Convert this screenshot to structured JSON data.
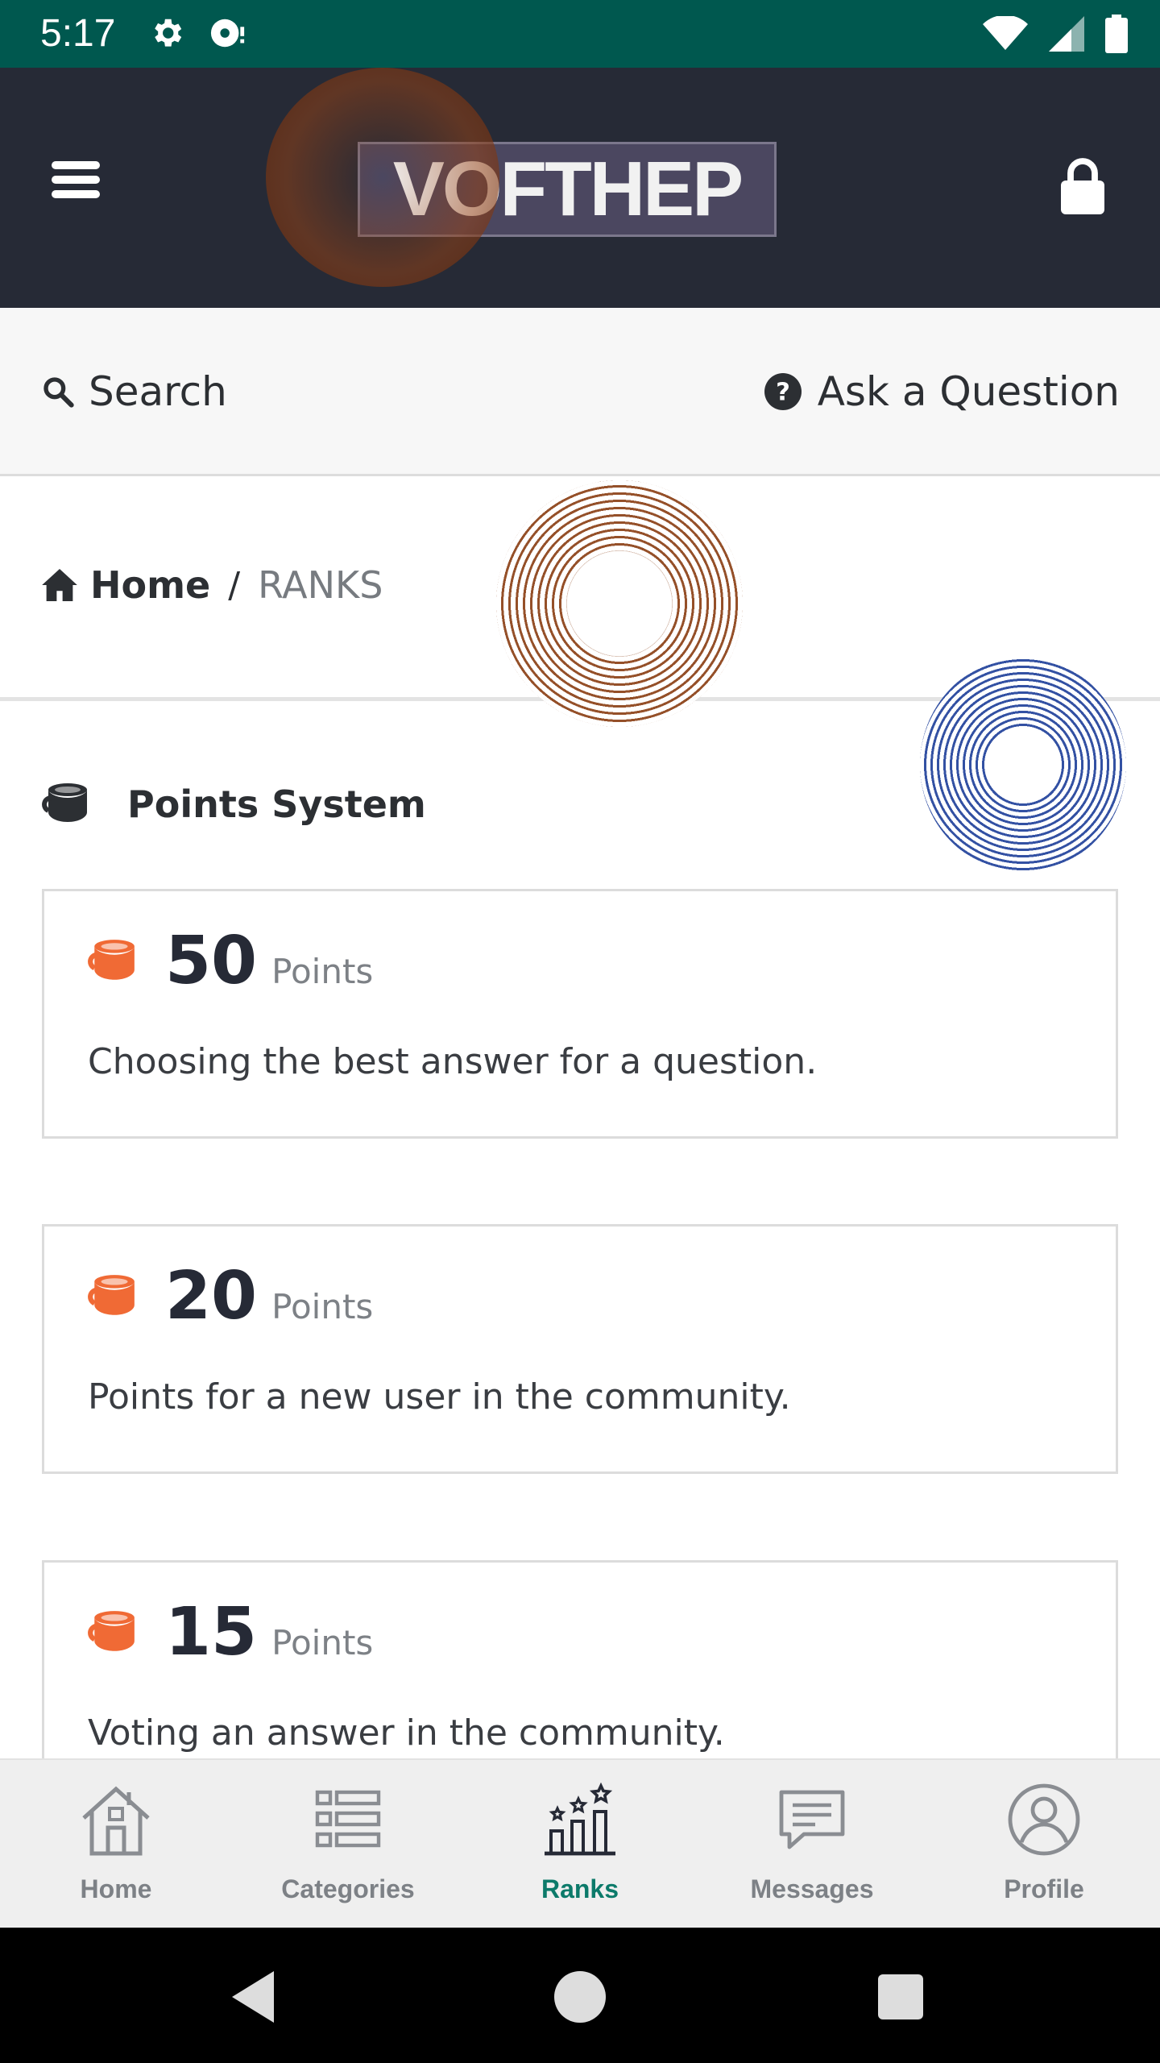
{
  "status_bar": {
    "time": "5:17",
    "left_icons": [
      "gear-icon",
      "media-icon"
    ],
    "right_icons": [
      "wifi-icon",
      "signal-icon",
      "battery-icon"
    ]
  },
  "header": {
    "logo_text": "VOFTHEP",
    "background": "#262a36"
  },
  "search_bar": {
    "search_label": "Search",
    "ask_label": "Ask a Question"
  },
  "breadcrumb": {
    "home": "Home",
    "separator": "/",
    "current": "RANKS"
  },
  "section": {
    "title": "Points System"
  },
  "points": [
    {
      "value": "50",
      "unit": "Points",
      "description": "Choosing the best answer for a question."
    },
    {
      "value": "20",
      "unit": "Points",
      "description": "Points for a new user in the community."
    },
    {
      "value": "15",
      "unit": "Points",
      "description": "Voting an answer in the community."
    }
  ],
  "bottom_nav": {
    "items": [
      {
        "label": "Home",
        "icon": "home-icon",
        "active": false
      },
      {
        "label": "Categories",
        "icon": "list-icon",
        "active": false
      },
      {
        "label": "Ranks",
        "icon": "ranks-icon",
        "active": true
      },
      {
        "label": "Messages",
        "icon": "message-icon",
        "active": false
      },
      {
        "label": "Profile",
        "icon": "profile-icon",
        "active": false
      }
    ]
  },
  "colors": {
    "status_bar": "#00584f",
    "accent": "#0c7a6a",
    "points_icon": "#f06a35"
  }
}
